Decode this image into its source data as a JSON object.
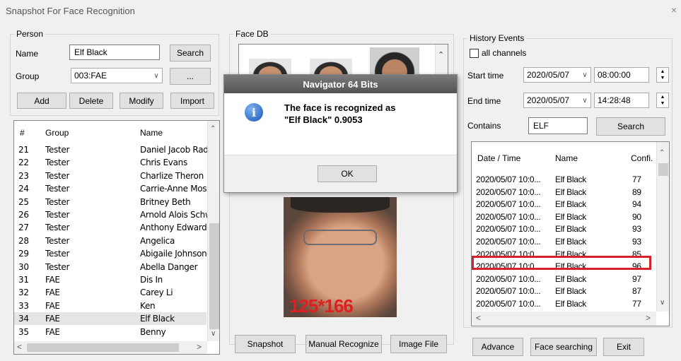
{
  "window": {
    "title": "Snapshot For Face Recognition",
    "close_glyph": "×"
  },
  "person": {
    "legend": "Person",
    "name_label": "Name",
    "name_value": "Elf Black",
    "search_btn": "Search",
    "group_label": "Group",
    "group_value": "003:FAE",
    "more_btn": "...",
    "add_btn": "Add",
    "delete_btn": "Delete",
    "modify_btn": "Modify",
    "import_btn": "Import"
  },
  "person_list": {
    "headers": [
      "#",
      "Group",
      "Name"
    ],
    "rows": [
      [
        "21",
        "Tester",
        "Daniel Jacob Rad.."
      ],
      [
        "22",
        "Tester",
        "Chris Evans"
      ],
      [
        "23",
        "Tester",
        "Charlize Theron"
      ],
      [
        "24",
        "Tester",
        "Carrie-Anne Moss"
      ],
      [
        "25",
        "Tester",
        "Britney Beth"
      ],
      [
        "26",
        "Tester",
        "Arnold Alois Schw.."
      ],
      [
        "27",
        "Tester",
        "Anthony Edward S.."
      ],
      [
        "28",
        "Tester",
        "Angelica"
      ],
      [
        "29",
        "Tester",
        "Abigaile Johnson"
      ],
      [
        "30",
        "Tester",
        "Abella Danger"
      ],
      [
        "31",
        "FAE",
        "Dis In"
      ],
      [
        "32",
        "FAE",
        "Carey Li"
      ],
      [
        "33",
        "FAE",
        "Ken"
      ],
      [
        "34",
        "FAE",
        "Elf Black"
      ],
      [
        "35",
        "FAE",
        "Benny"
      ]
    ]
  },
  "face_db": {
    "legend": "Face DB"
  },
  "snapshot": {
    "size_label": "125*166"
  },
  "center_buttons": {
    "snapshot": "Snapshot",
    "manual": "Manual Recognize",
    "image_file": "Image File"
  },
  "dialog": {
    "title": "Navigator 64 Bits",
    "message_line1": "The face is recognized as",
    "message_line2": "\"Elf Black\" 0.9053",
    "ok": "OK"
  },
  "history": {
    "legend": "History Events",
    "all_channels": "all channels",
    "start_label": "Start time",
    "start_date": "2020/05/07",
    "start_time": "08:00:00",
    "end_label": "End time",
    "end_date": "2020/05/07",
    "end_time": "14:28:48",
    "contains_label": "Contains",
    "contains_value": "ELF",
    "search_btn": "Search",
    "headers": [
      "Date / Time",
      "Name",
      "Confi."
    ],
    "rows": [
      [
        "2020/05/07 10:0...",
        "Elf Black",
        "77"
      ],
      [
        "2020/05/07 10:0...",
        "Elf Black",
        "89"
      ],
      [
        "2020/05/07 10:0...",
        "Elf Black",
        "94"
      ],
      [
        "2020/05/07 10:0...",
        "Elf Black",
        "90"
      ],
      [
        "2020/05/07 10:0...",
        "Elf Black",
        "93"
      ],
      [
        "2020/05/07 10:0...",
        "Elf Black",
        "93"
      ],
      [
        "2020/05/07 10:0...",
        "Elf Black",
        "85"
      ],
      [
        "2020/05/07 10:0...",
        "Elf Black",
        "96"
      ],
      [
        "2020/05/07 10:0...",
        "Elf Black",
        "97"
      ],
      [
        "2020/05/07 10:0...",
        "Elf Black",
        "87"
      ],
      [
        "2020/05/07 10:0...",
        "Elf Black",
        "77"
      ]
    ],
    "highlight_color": "#d8202a"
  },
  "bottom_buttons": {
    "advance": "Advance",
    "face_searching": "Face searching",
    "exit": "Exit"
  }
}
